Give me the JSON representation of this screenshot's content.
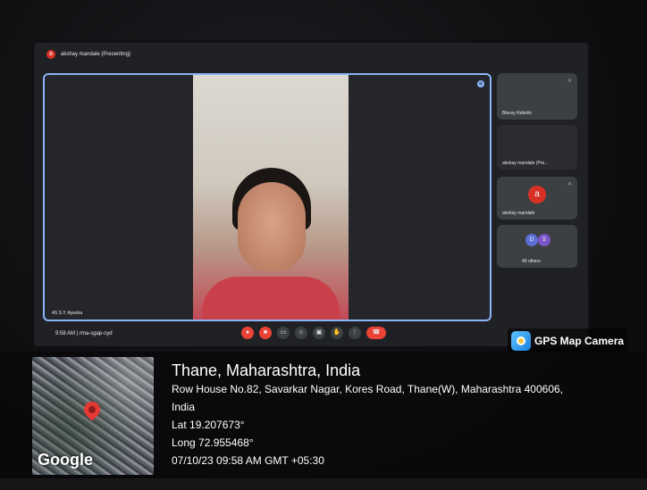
{
  "meeting": {
    "presenter_initial": "a",
    "presenter_label": "akshay mandale (Presenting)",
    "main_tile_name": "4S S.Y. Ayesha",
    "clock": "9:58 AM",
    "separator": "|",
    "meeting_code": "rma-sgap-cyd"
  },
  "participants": [
    {
      "name": "Blessy Rebello"
    },
    {
      "name": "akshay mandale (Pre..."
    },
    {
      "name": "akshay mandale",
      "initial": "a"
    },
    {
      "name": "49 others",
      "initials": [
        "D",
        "S"
      ]
    }
  ],
  "gps": {
    "brand": "GPS Map Camera",
    "city": "Thane, Maharashtra, India",
    "address": "Row House No.82, Savarkar Nagar, Kores Road, Thane(W), Maharashtra 400606,",
    "country": "India",
    "lat": "Lat 19.207673°",
    "long": "Long 72.955468°",
    "datetime": "07/10/23 09:58 AM GMT +05:30",
    "map_logo": "Google"
  },
  "colors": {
    "accent": "#8ab4f8",
    "end_call": "#ea4335",
    "avatar": "#d93025"
  },
  "icons": [
    "mic-icon",
    "camera-icon",
    "captions-icon",
    "emoji-icon",
    "present-icon",
    "hand-icon",
    "more-icon",
    "end-call-icon"
  ]
}
